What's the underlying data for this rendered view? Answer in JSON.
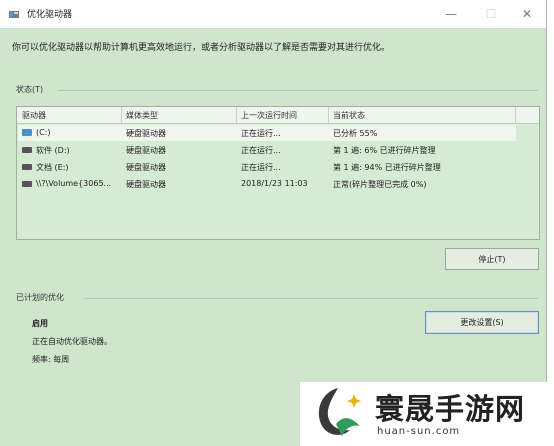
{
  "window": {
    "title": "优化驱动器"
  },
  "description": "你可以优化驱动器以帮助计算机更高效地运行，或者分析驱动器以了解是否需要对其进行优化。",
  "status_section": {
    "label": "状态(T)"
  },
  "columns": [
    "驱动器",
    "媒体类型",
    "上一次运行时间",
    "当前状态"
  ],
  "drives": [
    {
      "name": "(C:)",
      "media": "硬盘驱动器",
      "last_run": "正在运行...",
      "status": "已分析 55%"
    },
    {
      "name": "软件 (D:)",
      "media": "硬盘驱动器",
      "last_run": "正在运行...",
      "status": "第 1 遍: 6% 已进行碎片整理"
    },
    {
      "name": "文档 (E:)",
      "media": "硬盘驱动器",
      "last_run": "正在运行...",
      "status": "第 1 遍: 94% 已进行碎片整理"
    },
    {
      "name": "\\\\?\\Volume{3065...",
      "media": "硬盘驱动器",
      "last_run": "2018/1/23 11:03",
      "status": "正常(碎片整理已完成 0%)"
    }
  ],
  "stop_button": "停止(T)",
  "scheduled_section": {
    "label": "已计划的优化"
  },
  "schedule": {
    "state": "启用",
    "line1": "正在自动优化驱动器。",
    "line2": "频率: 每周"
  },
  "change_settings_button": "更改设置(S)",
  "watermark": {
    "text": "寰晟手游网",
    "url": "huan-sun.com"
  }
}
